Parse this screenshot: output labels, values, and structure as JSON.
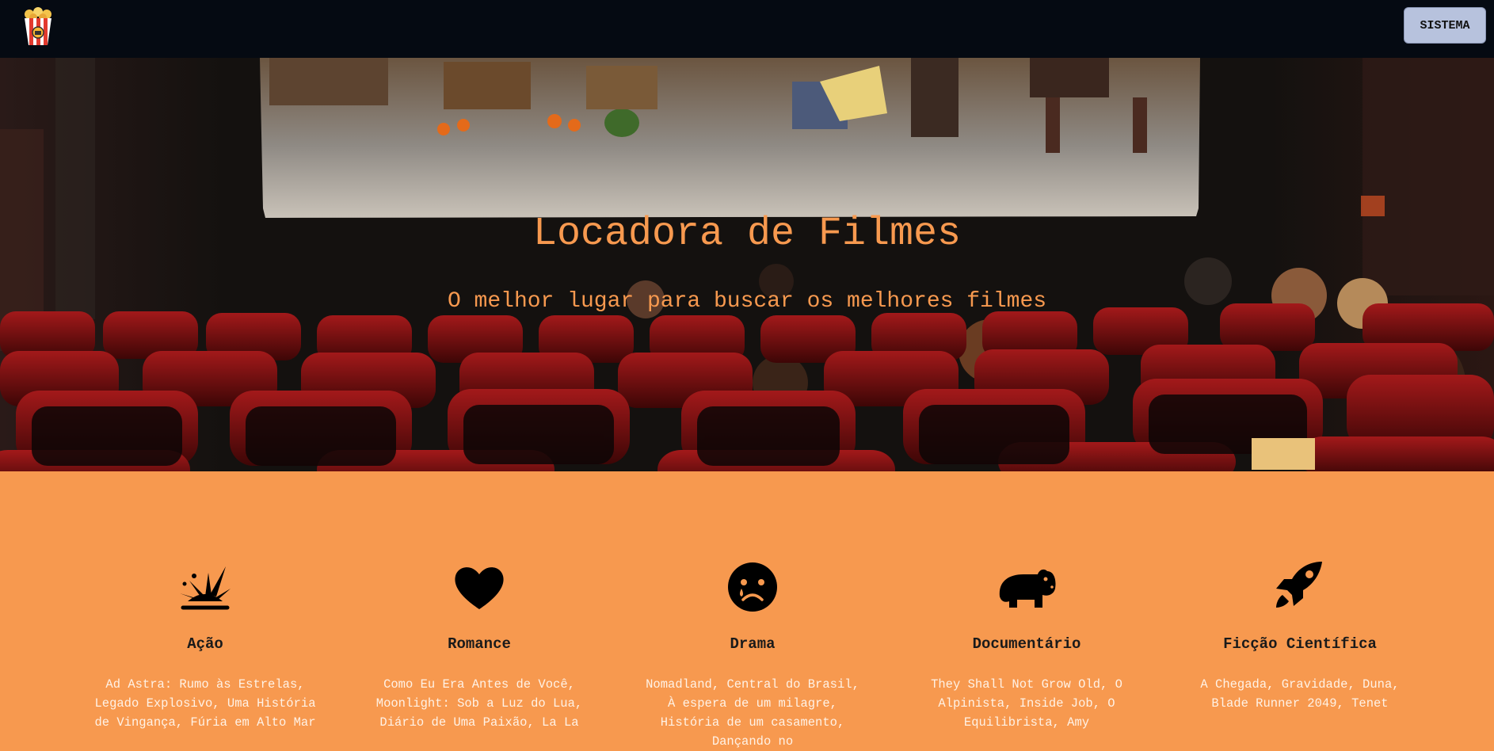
{
  "navbar": {
    "logo_icon": "popcorn-icon",
    "button_label": "SISTEMA"
  },
  "hero": {
    "title": "Locadora de Filmes",
    "subtitle": "O melhor lugar para buscar os melhores filmes"
  },
  "genres": [
    {
      "icon": "explosion-icon",
      "name": "Ação",
      "description": "Ad Astra: Rumo às Estrelas, Legado Explosivo, Uma História de Vingança, Fúria em Alto Mar"
    },
    {
      "icon": "heart-icon",
      "name": "Romance",
      "description": "Como Eu Era Antes de Você, Moonlight: Sob a Luz do Lua, Diário de Uma Paixão, La La"
    },
    {
      "icon": "sad-face-icon",
      "name": "Drama",
      "description": "Nomadland, Central do Brasil, À espera de um milagre, História de um casamento, Dançando no"
    },
    {
      "icon": "hippo-icon",
      "name": "Documentário",
      "description": "They Shall Not Grow Old, O Alpinista, Inside Job, O Equilibrista, Amy"
    },
    {
      "icon": "rocket-icon",
      "name": "Ficção Científica",
      "description": "A Chegada, Gravidade, Duna, Blade Runner 2049, Tenet"
    }
  ],
  "colors": {
    "accent": "#f7994f",
    "navbar": "#050a12",
    "button": "#b7c2dd"
  }
}
